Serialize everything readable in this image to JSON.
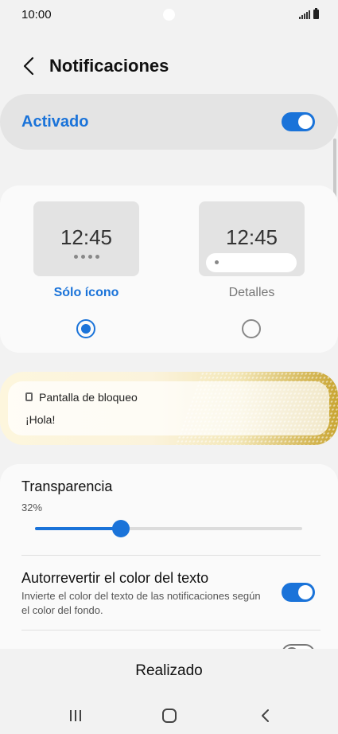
{
  "status_bar": {
    "time": "10:00"
  },
  "header": {
    "title": "Notificaciones"
  },
  "master": {
    "label": "Activado",
    "enabled": true
  },
  "style_options": {
    "preview_time": "12:45",
    "icon_only_label": "Sólo ícono",
    "details_label": "Detalles",
    "selected": "icon_only"
  },
  "lock_preview": {
    "title": "Pantalla de bloqueo",
    "body": "¡Hola!"
  },
  "transparency": {
    "label": "Transparencia",
    "value_text": "32%",
    "value_fraction": 0.32
  },
  "auto_invert": {
    "label": "Autorrevertir el color del texto",
    "description": "Invierte el color del texto de las notificaciones según el color del fondo.",
    "enabled": true
  },
  "bottom": {
    "done_label": "Realizado"
  },
  "colors": {
    "accent": "#1a73d9",
    "background": "#f2f2f2",
    "card": "#fafafa"
  },
  "icons": {
    "back": "chevron-left-icon",
    "recents": "recents-icon",
    "home": "home-icon",
    "nav_back": "nav-back-icon"
  }
}
